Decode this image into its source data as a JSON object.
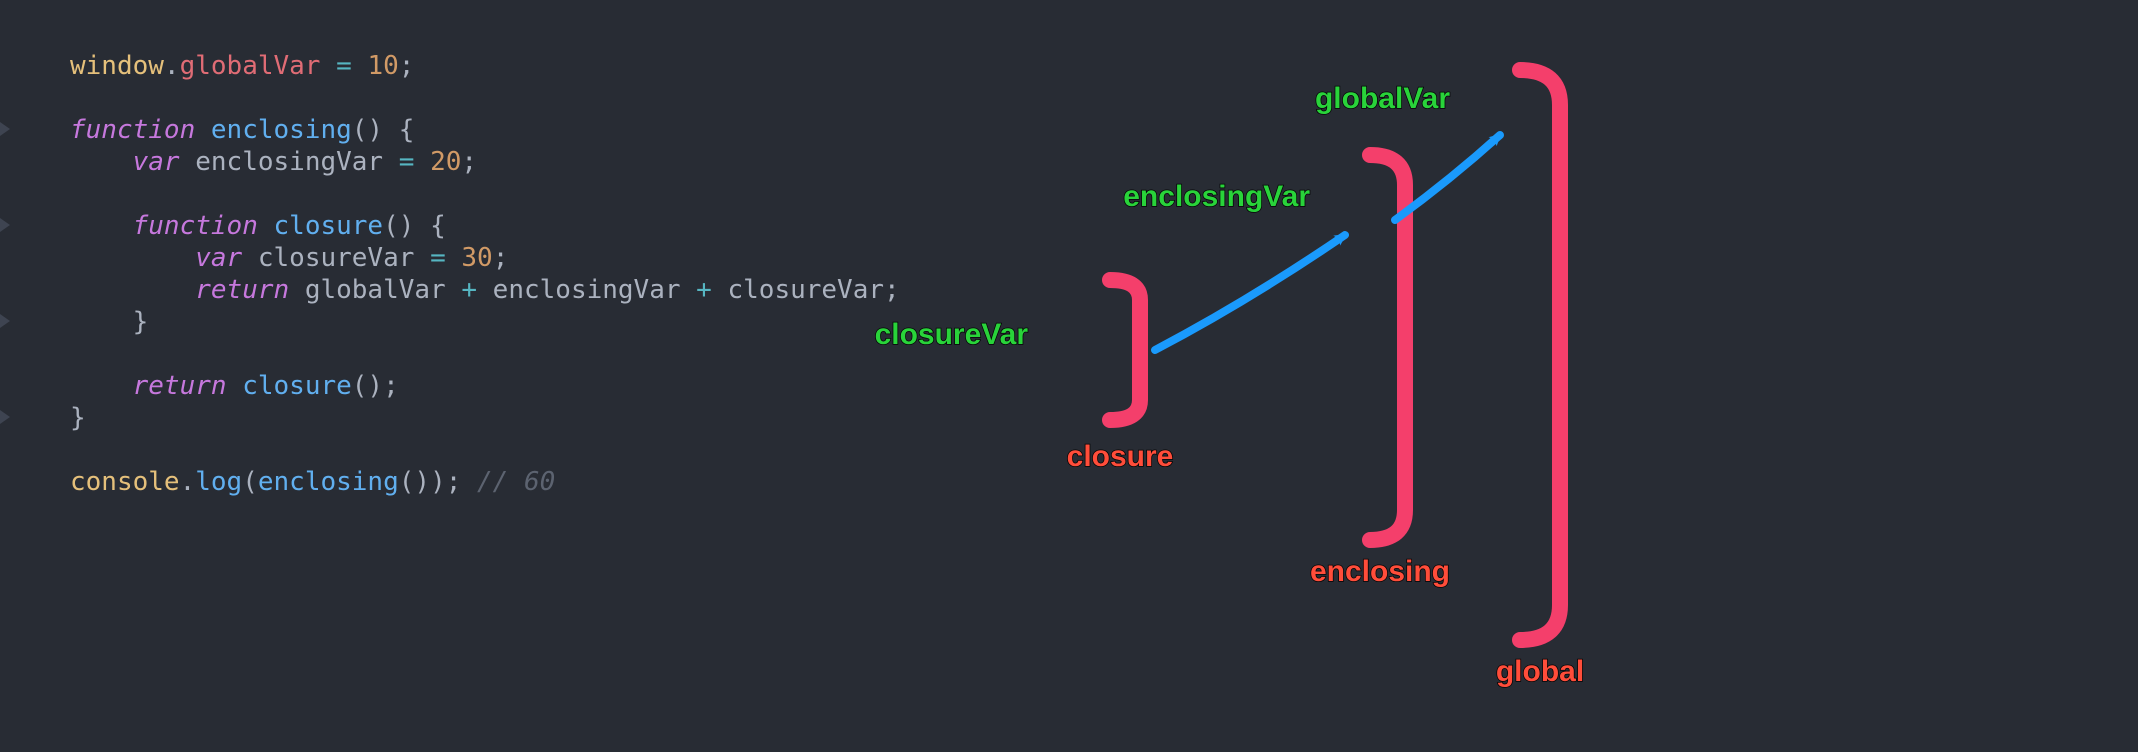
{
  "code": {
    "l1": {
      "window": "window",
      "dot1": ".",
      "prop": "globalVar",
      "sp": " ",
      "eq": "=",
      "sp2": " ",
      "num": "10",
      "semi": ";"
    },
    "l3": {
      "kw": "function",
      "sp": " ",
      "name": "enclosing",
      "paren": "()",
      "sp2": " ",
      "brace": "{"
    },
    "l4": {
      "indent": "    ",
      "var": "var",
      "sp": " ",
      "ident": "enclosingVar",
      "sp2": " ",
      "eq": "=",
      "sp3": " ",
      "num": "20",
      "semi": ";"
    },
    "l6": {
      "indent": "    ",
      "kw": "function",
      "sp": " ",
      "name": "closure",
      "paren": "()",
      "sp2": " ",
      "brace": "{"
    },
    "l7": {
      "indent": "        ",
      "var": "var",
      "sp": " ",
      "ident": "closureVar",
      "sp2": " ",
      "eq": "=",
      "sp3": " ",
      "num": "30",
      "semi": ";"
    },
    "l8": {
      "indent": "        ",
      "ret": "return",
      "sp": " ",
      "a": "globalVar",
      "sp2": " ",
      "p1": "+",
      "sp3": " ",
      "b": "enclosingVar",
      "sp4": " ",
      "p2": "+",
      "sp5": " ",
      "c": "closureVar",
      "semi": ";"
    },
    "l9": {
      "indent": "    ",
      "brace": "}"
    },
    "l11": {
      "indent": "    ",
      "ret": "return",
      "sp": " ",
      "call": "closure",
      "paren": "()",
      "semi": ";"
    },
    "l12": {
      "brace": "}"
    },
    "l14": {
      "console": "console",
      "dot": ".",
      "log": "log",
      "lp": "(",
      "call": "enclosing",
      "paren": "()",
      "rp": ")",
      "semi": ";",
      "sp": " ",
      "comment": "// 60"
    }
  },
  "diagram": {
    "scopes": {
      "closure": "closure",
      "enclosing": "enclosing",
      "global": "global"
    },
    "vars": {
      "closureVar": "closureVar",
      "enclosingVar": "enclosingVar",
      "globalVar": "globalVar"
    },
    "colors": {
      "bracket": "#f43f6b",
      "arrow": "#1a9afc",
      "scopeLabel": "#ff4d3a",
      "varLabel": "#29d33a"
    }
  }
}
